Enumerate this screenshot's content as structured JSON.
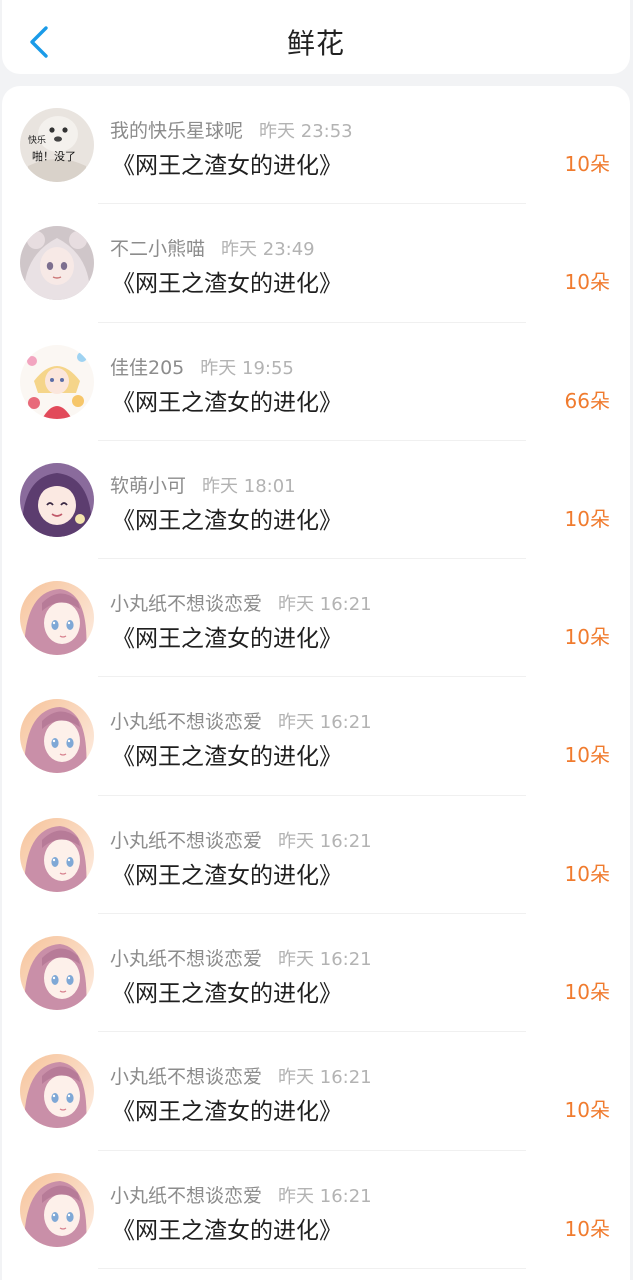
{
  "header": {
    "title": "鲜花",
    "back_icon": "chevron-left-icon",
    "accent": "#1a9be8"
  },
  "colors": {
    "amount": "#f07b2e"
  },
  "items": [
    {
      "name": "我的快乐星球呢",
      "time": "昨天 23:53",
      "book": "《网王之渣女的进化》",
      "amount": "10朵",
      "avatar": "meme",
      "avatar_text": [
        "快乐",
        "啪！没了"
      ]
    },
    {
      "name": "不二小熊喵",
      "time": "昨天 23:49",
      "book": "《网王之渣女的进化》",
      "amount": "10朵",
      "avatar": "bear-girl"
    },
    {
      "name": "佳佳205",
      "time": "昨天 19:55",
      "book": "《网王之渣女的进化》",
      "amount": "66朵",
      "avatar": "flower-girl"
    },
    {
      "name": "软萌小可",
      "time": "昨天 18:01",
      "book": "《网王之渣女的进化》",
      "amount": "10朵",
      "avatar": "smile-girl"
    },
    {
      "name": "小丸纸不想谈恋爱",
      "time": "昨天 16:21",
      "book": "《网王之渣女的进化》",
      "amount": "10朵",
      "avatar": "anime-girl"
    },
    {
      "name": "小丸纸不想谈恋爱",
      "time": "昨天 16:21",
      "book": "《网王之渣女的进化》",
      "amount": "10朵",
      "avatar": "anime-girl"
    },
    {
      "name": "小丸纸不想谈恋爱",
      "time": "昨天 16:21",
      "book": "《网王之渣女的进化》",
      "amount": "10朵",
      "avatar": "anime-girl"
    },
    {
      "name": "小丸纸不想谈恋爱",
      "time": "昨天 16:21",
      "book": "《网王之渣女的进化》",
      "amount": "10朵",
      "avatar": "anime-girl"
    },
    {
      "name": "小丸纸不想谈恋爱",
      "time": "昨天 16:21",
      "book": "《网王之渣女的进化》",
      "amount": "10朵",
      "avatar": "anime-girl"
    },
    {
      "name": "小丸纸不想谈恋爱",
      "time": "昨天 16:21",
      "book": "《网王之渣女的进化》",
      "amount": "10朵",
      "avatar": "anime-girl"
    }
  ]
}
